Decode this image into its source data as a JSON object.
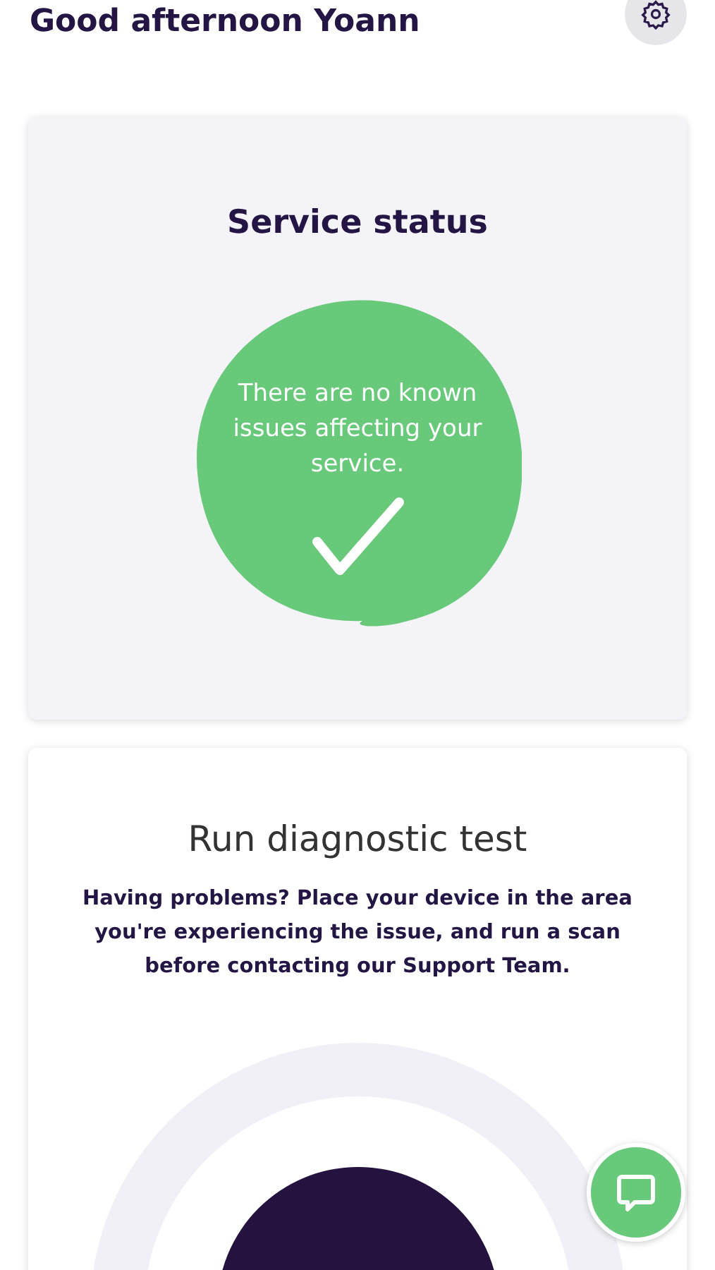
{
  "header": {
    "greeting": "Good afternoon Yoann"
  },
  "service_status": {
    "title": "Service status",
    "message": "There are no known issues affecting your service.",
    "ok": true
  },
  "diagnostic": {
    "title": "Run diagnostic test",
    "description": "Having problems? Place your device in the area you're experiencing the issue, and run a scan before contacting our Support Team."
  }
}
